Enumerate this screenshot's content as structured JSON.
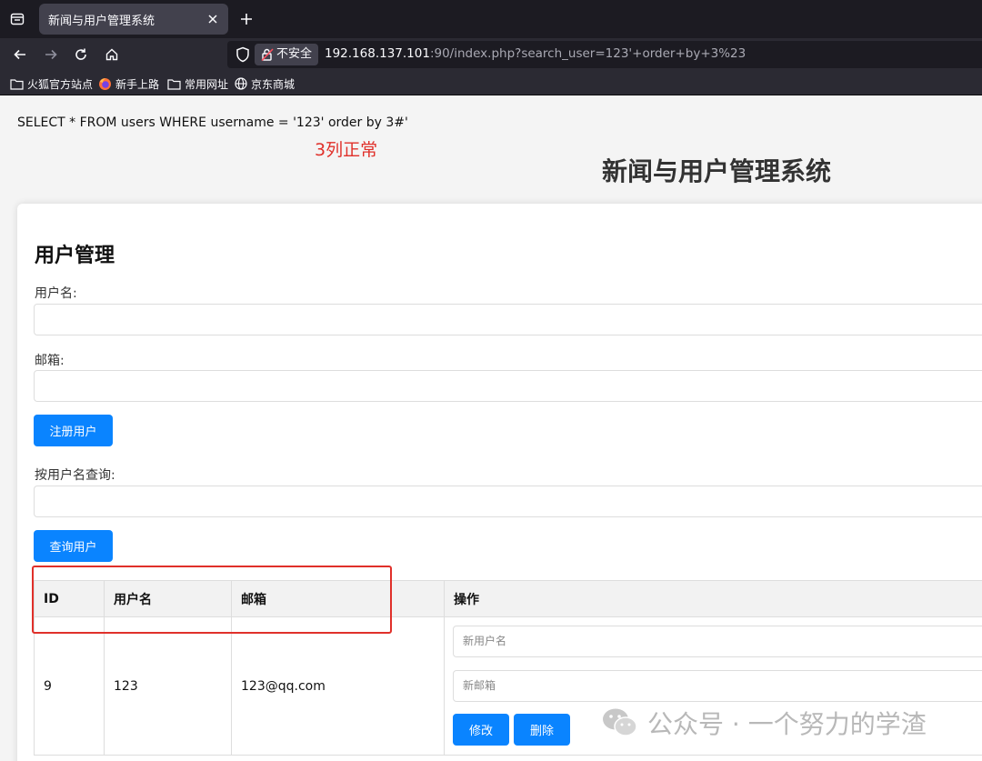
{
  "browser": {
    "tab_title": "新闻与用户管理系统",
    "security_label": "不安全",
    "url_host": "192.168.137.101",
    "url_rest": ":90/index.php?search_user=123'+order+by+3%23",
    "bookmarks": [
      "火狐官方站点",
      "新手上路",
      "常用网址",
      "京东商城"
    ]
  },
  "page": {
    "sql_text": "SELECT * FROM users WHERE username = '123' order by 3#'",
    "note": "3列正常",
    "system_title": "新闻与用户管理系统",
    "section_title": "用户管理",
    "username_label": "用户名:",
    "email_label": "邮箱:",
    "register_button": "注册用户",
    "search_label": "按用户名查询:",
    "search_button": "查询用户"
  },
  "table": {
    "headers": [
      "ID",
      "用户名",
      "邮箱",
      "操作"
    ],
    "rows": [
      {
        "id": "9",
        "username": "123",
        "email": "123@qq.com",
        "new_username_placeholder": "新用户名",
        "new_email_placeholder": "新邮箱",
        "edit_label": "修改",
        "delete_label": "删除"
      }
    ]
  },
  "watermark": "公众号 · 一个努力的学渣",
  "colors": {
    "accent_blue": "#0a84ff",
    "annotation_red": "#e0302a",
    "chrome_dark": "#1c1b22"
  }
}
